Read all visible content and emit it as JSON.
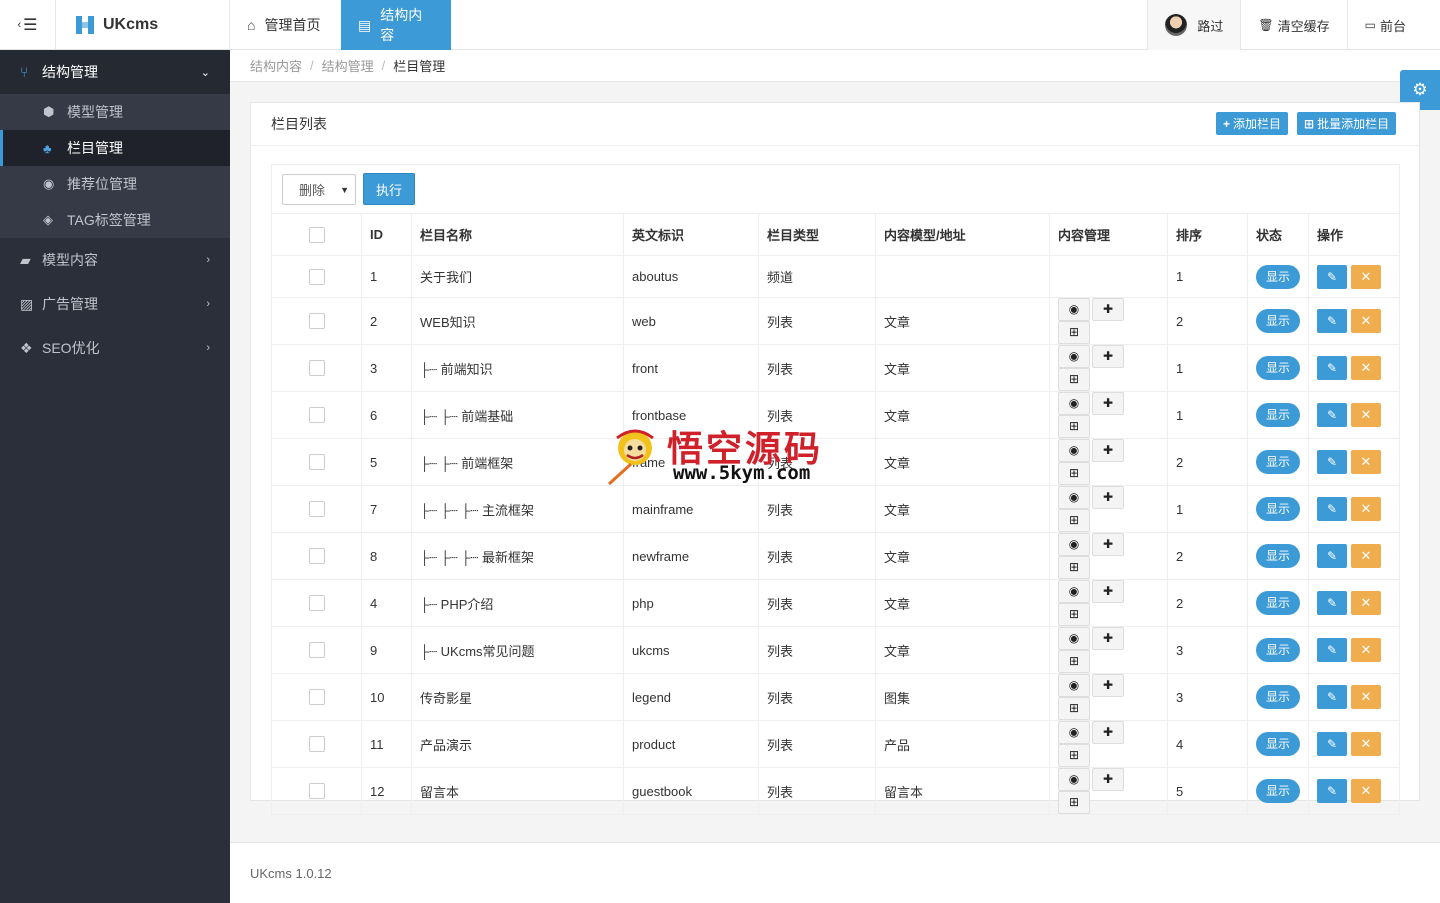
{
  "topbar": {
    "brand": "UKcms",
    "nav": [
      {
        "label": "管理首页",
        "icon": "home-icon"
      },
      {
        "label": "结构内容",
        "icon": "file-icon"
      }
    ],
    "user": "路过",
    "clear_cache": "清空缓存",
    "frontend": "前台"
  },
  "sidebar": {
    "groups": [
      {
        "label": "结构管理",
        "icon": "sitemap-icon",
        "open": true,
        "items": [
          {
            "label": "模型管理",
            "icon": "cube-icon"
          },
          {
            "label": "栏目管理",
            "icon": "tree-icon",
            "active": true
          },
          {
            "label": "推荐位管理",
            "icon": "target-icon"
          },
          {
            "label": "TAG标签管理",
            "icon": "tags-icon"
          }
        ]
      },
      {
        "label": "模型内容",
        "icon": "folder-icon"
      },
      {
        "label": "广告管理",
        "icon": "image-icon"
      },
      {
        "label": "SEO优化",
        "icon": "paw-icon"
      }
    ]
  },
  "breadcrumb": [
    "结构内容",
    "结构管理",
    "栏目管理"
  ],
  "panel": {
    "title": "栏目列表",
    "add_btn": "添加栏目",
    "batch_add_btn": "批量添加栏目",
    "action_select": "删除",
    "exec_btn": "执行"
  },
  "table": {
    "headers": [
      "ID",
      "栏目名称",
      "英文标识",
      "栏目类型",
      "内容模型/地址",
      "内容管理",
      "排序",
      "状态",
      "操作"
    ],
    "status_label": "显示",
    "rows": [
      {
        "id": "1",
        "name": "关于我们",
        "ident": "aboutus",
        "type": "频道",
        "model": "",
        "manage": false,
        "sort": "1"
      },
      {
        "id": "2",
        "name": "WEB知识",
        "ident": "web",
        "type": "列表",
        "model": "文章",
        "manage": true,
        "sort": "2"
      },
      {
        "id": "3",
        "name": "├┈ 前端知识",
        "ident": "front",
        "type": "列表",
        "model": "文章",
        "manage": true,
        "sort": "1"
      },
      {
        "id": "6",
        "name": "├┈ ├┈ 前端基础",
        "ident": "frontbase",
        "type": "列表",
        "model": "文章",
        "manage": true,
        "sort": "1"
      },
      {
        "id": "5",
        "name": "├┈ ├┈ 前端框架",
        "ident": "frame",
        "type": "列表",
        "model": "文章",
        "manage": true,
        "sort": "2"
      },
      {
        "id": "7",
        "name": "├┈ ├┈ ├┈ 主流框架",
        "ident": "mainframe",
        "type": "列表",
        "model": "文章",
        "manage": true,
        "sort": "1"
      },
      {
        "id": "8",
        "name": "├┈ ├┈ ├┈ 最新框架",
        "ident": "newframe",
        "type": "列表",
        "model": "文章",
        "manage": true,
        "sort": "2"
      },
      {
        "id": "4",
        "name": "├┈ PHP介绍",
        "ident": "php",
        "type": "列表",
        "model": "文章",
        "manage": true,
        "sort": "2"
      },
      {
        "id": "9",
        "name": "├┈ UKcms常见问题",
        "ident": "ukcms",
        "type": "列表",
        "model": "文章",
        "manage": true,
        "sort": "3"
      },
      {
        "id": "10",
        "name": "传奇影星",
        "ident": "legend",
        "type": "列表",
        "model": "图集",
        "manage": true,
        "sort": "3"
      },
      {
        "id": "11",
        "name": "产品演示",
        "ident": "product",
        "type": "列表",
        "model": "产品",
        "manage": true,
        "sort": "4"
      },
      {
        "id": "12",
        "name": "留言本",
        "ident": "guestbook",
        "type": "列表",
        "model": "留言本",
        "manage": true,
        "sort": "5"
      }
    ]
  },
  "footer": "UKcms 1.0.12",
  "watermark": {
    "title": "悟空源码",
    "url": "www.5kym.com"
  },
  "colors": {
    "primary": "#3c9ad6",
    "warning": "#f0ad4e",
    "sidebar": "#2b2f3a"
  }
}
